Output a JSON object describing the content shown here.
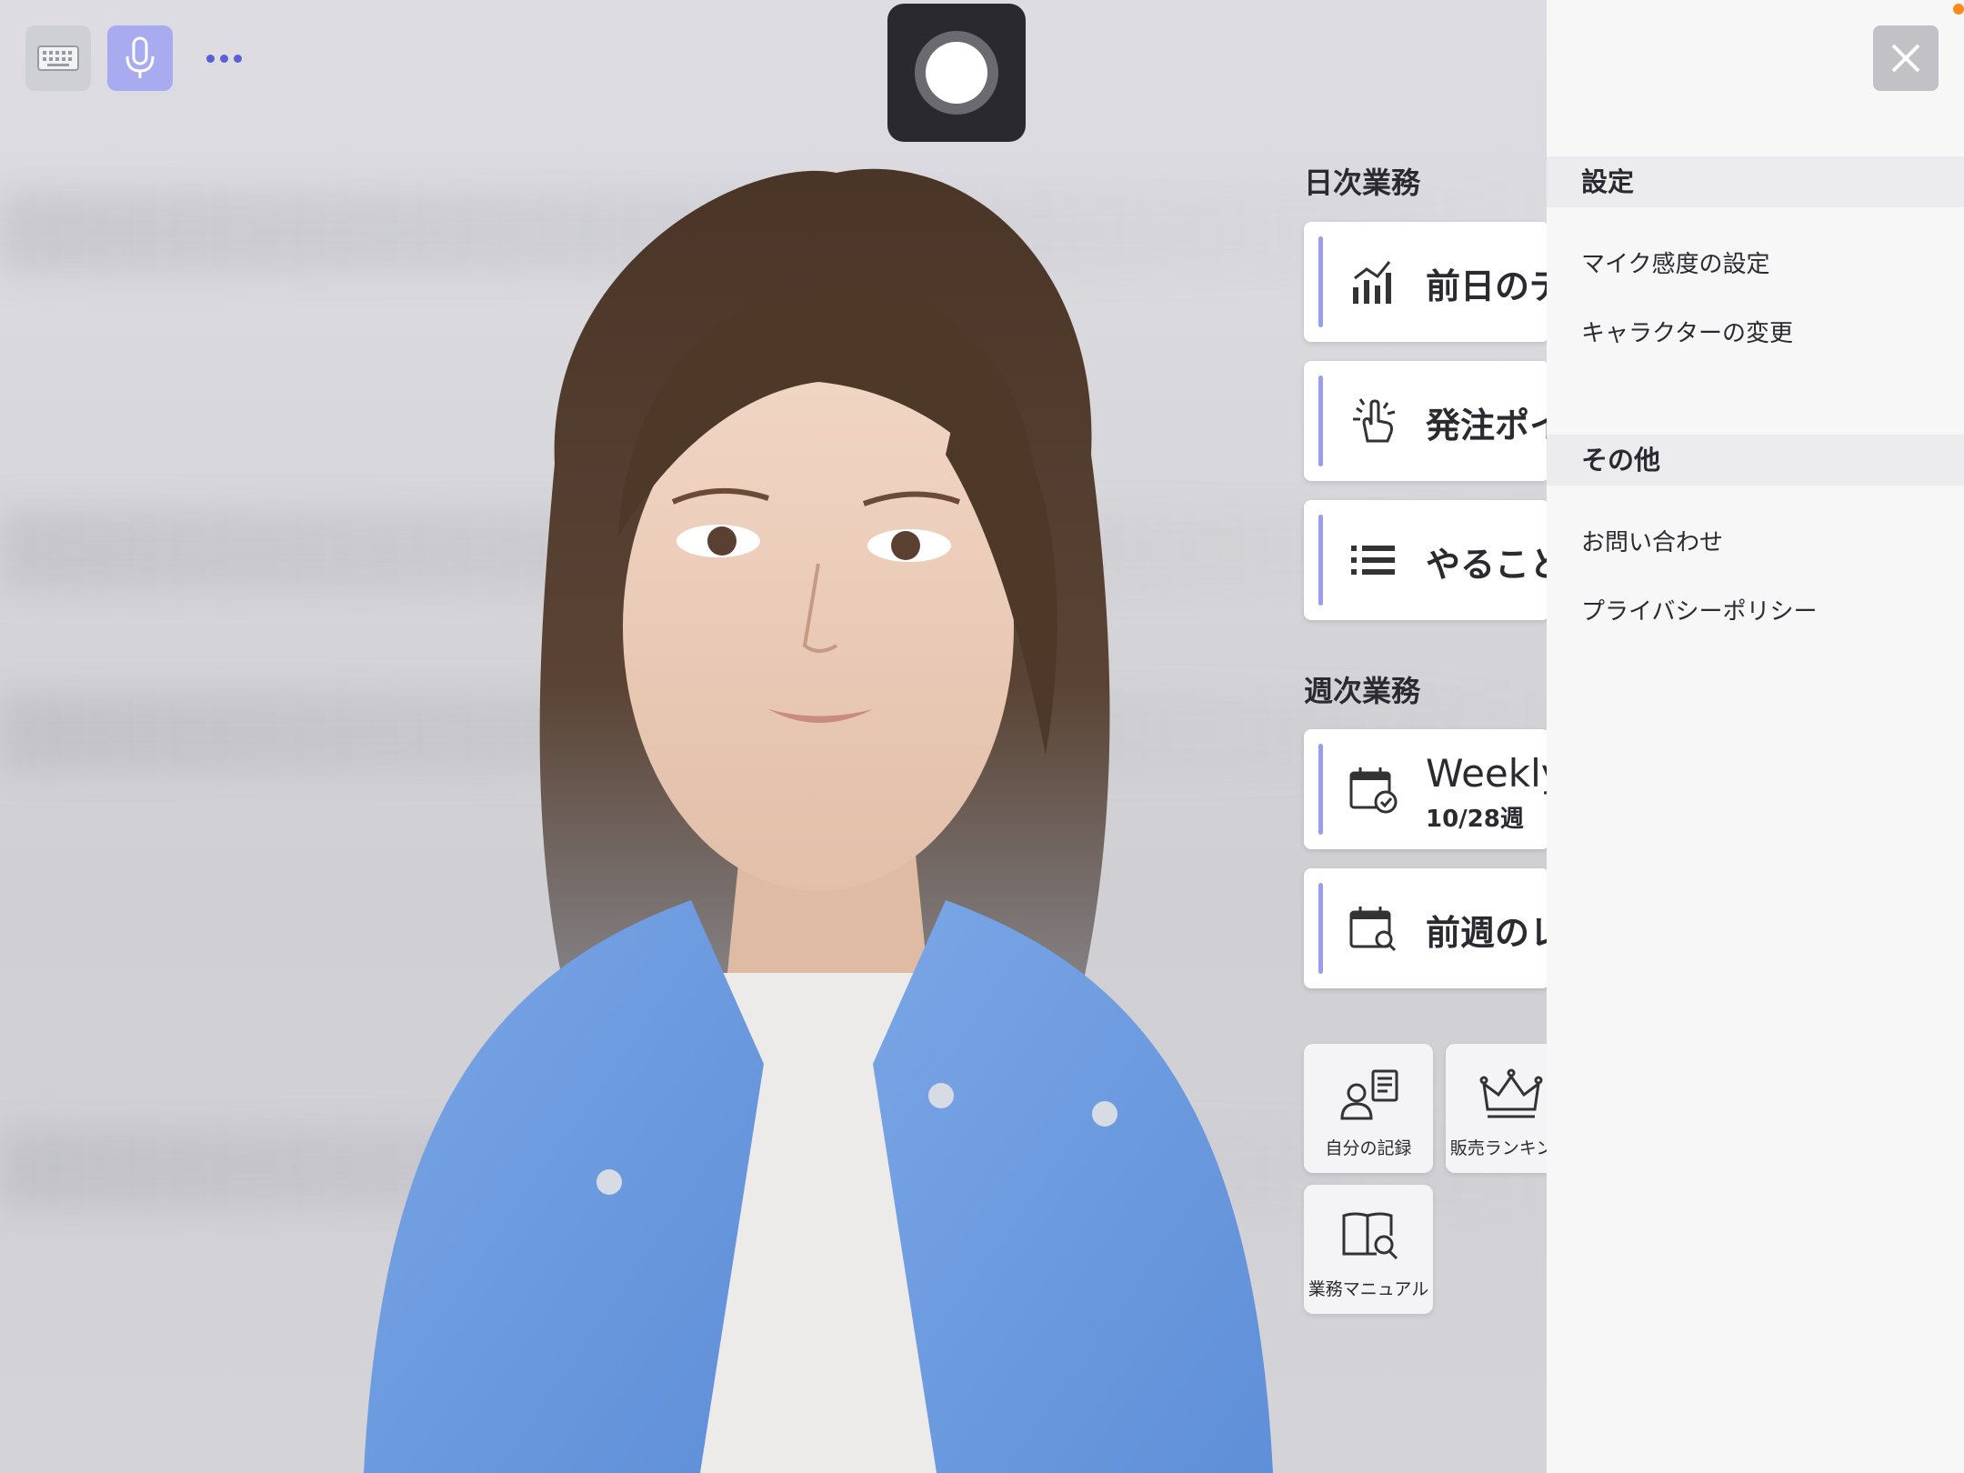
{
  "toolbar": {
    "keyboard_icon": "keyboard-icon",
    "mic_icon": "microphone-icon",
    "more_icon": "more-dots-icon"
  },
  "record": {
    "icon": "record-icon"
  },
  "daily": {
    "title": "日次業務",
    "items": [
      {
        "label": "前日のデ",
        "icon": "bar-chart-icon"
      },
      {
        "label": "発注ポイ",
        "icon": "hand-point-icon"
      },
      {
        "label": "やること",
        "icon": "list-icon"
      }
    ]
  },
  "weekly": {
    "title": "週次業務",
    "items": [
      {
        "label": "Weekly",
        "sub": "10/28週",
        "icon": "calendar-check-icon"
      },
      {
        "label": "前週のレ",
        "icon": "calendar-search-icon"
      }
    ]
  },
  "tiles": [
    {
      "label": "自分の記録",
      "icon": "user-record-icon"
    },
    {
      "label": "販売ランキング",
      "icon": "crown-icon"
    },
    {
      "label": "業務マニュアル",
      "icon": "book-search-icon"
    }
  ],
  "settings_panel": {
    "close_icon": "close-icon",
    "sections": [
      {
        "header": "設定",
        "items": [
          "マイク感度の設定",
          "キャラクターの変更"
        ]
      },
      {
        "header": "その他",
        "items": [
          "お問い合わせ",
          "プライバシーポリシー"
        ]
      }
    ]
  },
  "colors": {
    "accent": "#9a9cf0",
    "mic_active": "#a9abf0",
    "record_bg": "#2a2a2e",
    "panel_bg": "#f7f7f7",
    "jacket": "#6d9de0"
  }
}
